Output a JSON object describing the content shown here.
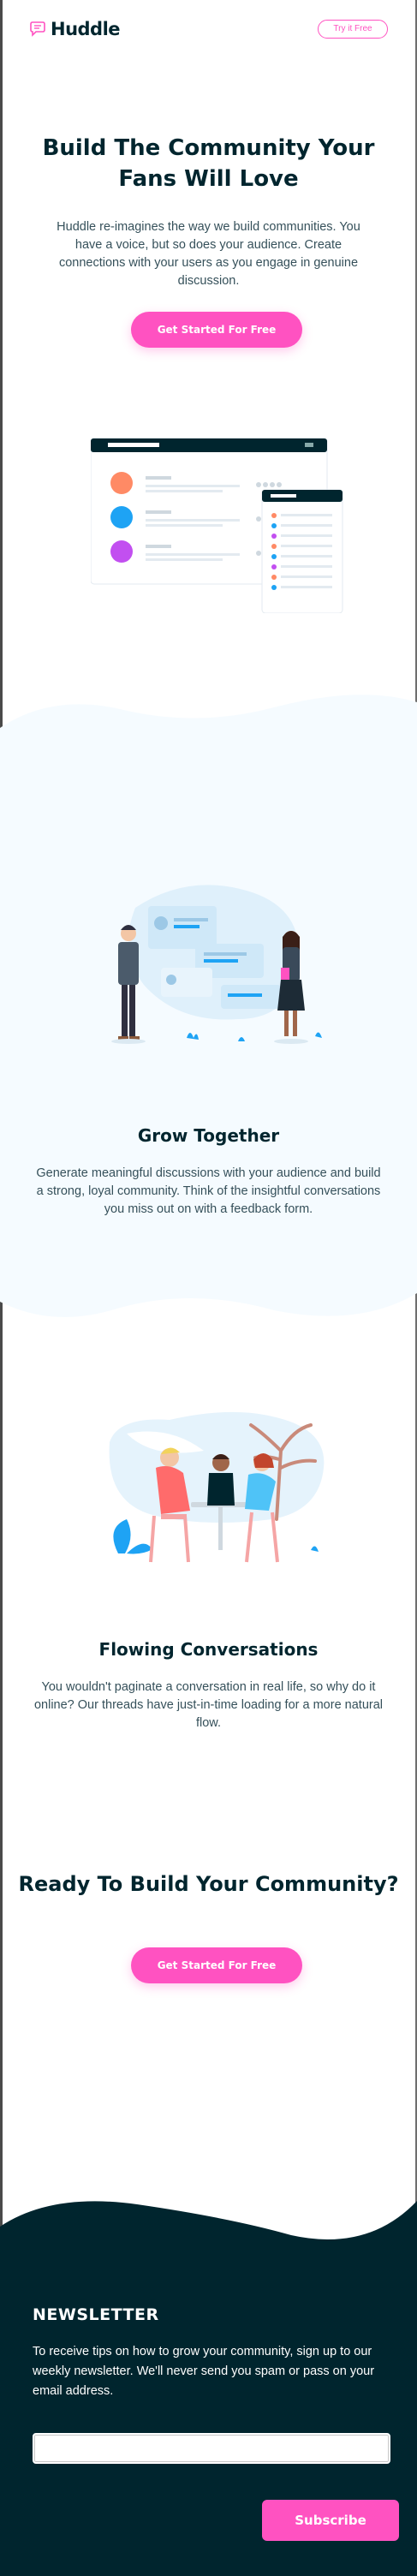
{
  "header": {
    "logo_text": "Huddle",
    "logo_icon": "chat-bubble-icon",
    "try_button": "Try it Free"
  },
  "hero": {
    "title": "Build The Community Your Fans Will Love",
    "text": "Huddle re-imagines the way we build communities. You have a voice, but so does your audience. Create connections with your users as you engage in genuine discussion.",
    "cta": "Get Started For Free",
    "mockup_icon": "app-mockup-illustration"
  },
  "features": [
    {
      "title": "Grow Together",
      "text": "Generate meaningful discussions with your audience and build a strong, loyal community. Think of the insightful conversations you miss out on with a feedback form.",
      "illustration": "people-presenting-illustration"
    },
    {
      "title": "Flowing Conversations",
      "text": "You wouldn't paginate a conversation in real life, so why do it online? Our threads have just-in-time loading for a more natural flow.",
      "illustration": "people-at-table-illustration"
    }
  ],
  "final_cta": {
    "title": "Ready To Build Your Community?",
    "button": "Get Started For Free"
  },
  "newsletter": {
    "title": "NEWSLETTER",
    "text": "To receive tips on how to grow your community, sign up to our weekly newsletter. We'll never send you spam or pass on your email address.",
    "input_value": "",
    "button": "Subscribe"
  },
  "colors": {
    "primary": "#ff52c1",
    "dark": "#00252e",
    "light_bg": "#f5fbff"
  }
}
